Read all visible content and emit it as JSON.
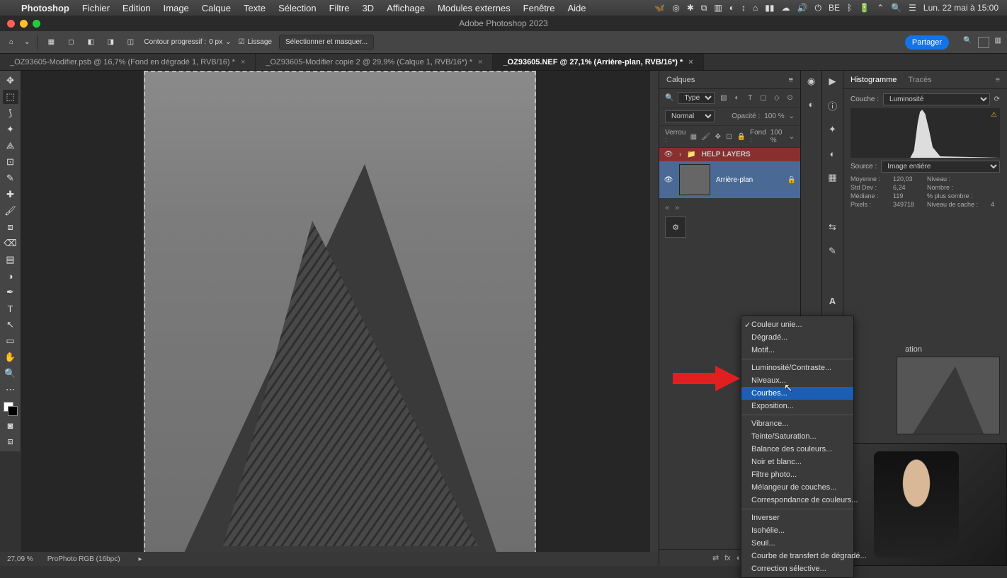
{
  "macos": {
    "app": "Photoshop",
    "menus": [
      "Fichier",
      "Edition",
      "Image",
      "Calque",
      "Texte",
      "Sélection",
      "Filtre",
      "3D",
      "Affichage",
      "Modules externes",
      "Fenêtre",
      "Aide"
    ],
    "clock": "Lun. 22 mai à 15:00"
  },
  "window": {
    "title": "Adobe Photoshop 2023"
  },
  "options": {
    "contour_label": "Contour progressif :",
    "contour_value": "0 px",
    "lissage": "Lissage",
    "select_mask": "Sélectionner et masquer...",
    "share": "Partager"
  },
  "tabs": [
    {
      "label": "_OZ93605-Modifier.psb @ 16,7% (Fond en dégradé 1, RVB/16) *",
      "active": false
    },
    {
      "label": "_OZ93605-Modifier copie 2 @ 29,9% (Calque 1, RVB/16*) *",
      "active": false
    },
    {
      "label": "_OZ93605.NEF @ 27,1% (Arrière-plan, RVB/16*) *",
      "active": true
    }
  ],
  "status": {
    "zoom": "27,09 %",
    "profile": "ProPhoto RGB (16bpc)"
  },
  "layers": {
    "title": "Calques",
    "filter_label": "Type",
    "blend": "Normal",
    "opacity_label": "Opacité :",
    "opacity_value": "100 %",
    "lock_label": "Verrou :",
    "fill_label": "Fond :",
    "fill_value": "100 %",
    "group": "HELP LAYERS",
    "bg_layer": "Arrière-plan"
  },
  "histogram": {
    "tab1": "Histogramme",
    "tab2": "Tracés",
    "couche_label": "Couche :",
    "couche_value": "Luminosité",
    "source_label": "Source :",
    "source_value": "Image entière",
    "stats": {
      "moyenne_l": "Moyenne :",
      "moyenne_v": "120,03",
      "stddev_l": "Std Dev :",
      "stddev_v": "6,24",
      "mediane_l": "Médiane :",
      "mediane_v": "119",
      "pixels_l": "Pixels :",
      "pixels_v": "349718",
      "niveau_l": "Niveau :",
      "nombre_l": "Nombre :",
      "pourcent_l": "% plus sombre :",
      "cache_l": "Niveau de cache :",
      "cache_v": "4"
    }
  },
  "nav_title": "ation",
  "adj_menu": {
    "items": [
      {
        "t": "Couleur unie...",
        "check": true
      },
      {
        "t": "Dégradé..."
      },
      {
        "t": "Motif..."
      },
      {
        "sep": true
      },
      {
        "t": "Luminosité/Contraste...",
        "boxed": true
      },
      {
        "t": "Niveaux...",
        "boxed": true
      },
      {
        "t": "Courbes...",
        "hl": true,
        "boxed": true
      },
      {
        "t": "Exposition...",
        "boxed": true
      },
      {
        "sep": true
      },
      {
        "t": "Vibrance..."
      },
      {
        "t": "Teinte/Saturation..."
      },
      {
        "t": "Balance des couleurs..."
      },
      {
        "t": "Noir et blanc..."
      },
      {
        "t": "Filtre photo..."
      },
      {
        "t": "Mélangeur de couches..."
      },
      {
        "t": "Correspondance de couleurs..."
      },
      {
        "sep": true
      },
      {
        "t": "Inverser"
      },
      {
        "t": "Isohélie..."
      },
      {
        "t": "Seuil..."
      },
      {
        "t": "Courbe de transfert de dégradé..."
      },
      {
        "t": "Correction sélective..."
      }
    ]
  }
}
